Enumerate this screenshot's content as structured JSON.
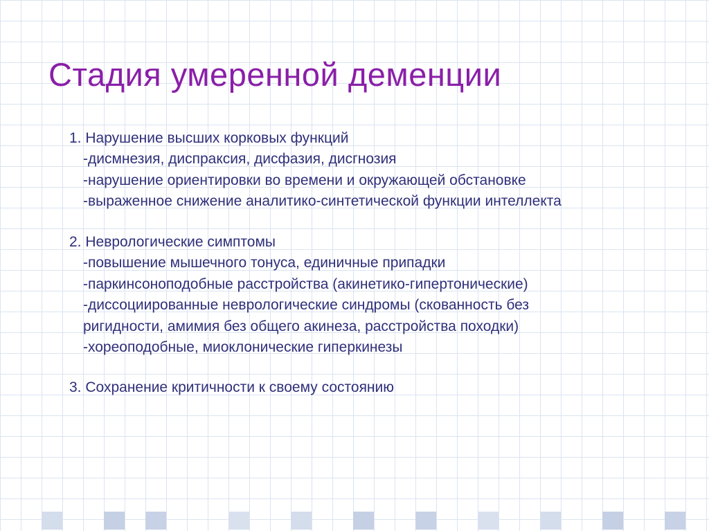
{
  "title": "Стадия умеренной деменции",
  "sections": [
    {
      "head": "1. Нарушение высших корковых функций",
      "items": [
        "-дисмнезия, диспраксия, дисфазия, дисгнозия",
        "-нарушение ориентировки во времени и окружающей обстановке",
        "-выраженное снижение аналитико-синтетической функции интеллекта"
      ]
    },
    {
      "head": "2. Неврологические симптомы",
      "items": [
        "-повышение мышечного тонуса, единичные припадки",
        "-паркинсоноподобные расстройства (акинетико-гипертонические)",
        "-диссоциированные неврологические синдромы (скованность без",
        " ригидности, амимия без общего акинеза, расстройства походки)",
        "-хореоподобные, миоклонические гиперкинезы"
      ]
    },
    {
      "head": "3. Сохранение критичности к своему состоянию",
      "items": []
    }
  ]
}
